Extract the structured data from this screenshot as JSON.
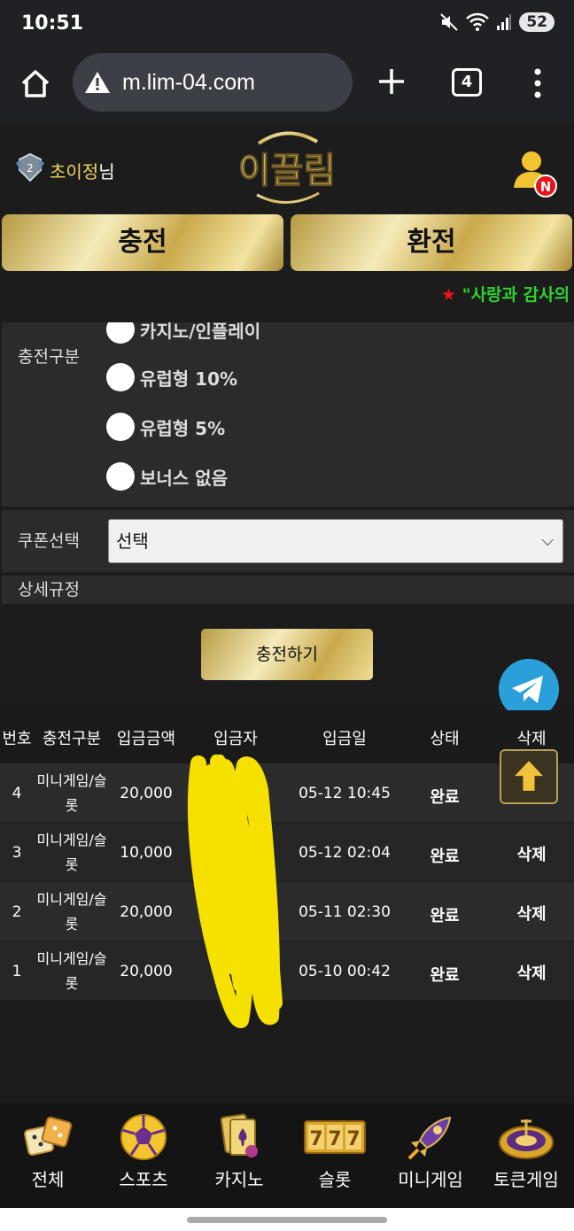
{
  "status_bar": {
    "time": "10:51",
    "battery": "52"
  },
  "browser": {
    "url": "m.lim-04.com",
    "tab_count": "4"
  },
  "header": {
    "username": "초이정",
    "username_suffix": "님",
    "logo_text": "이끌림",
    "notif_badge": "N"
  },
  "actions": {
    "charge": "충전",
    "exchange": "환전"
  },
  "marquee": {
    "star": "★",
    "text": "\"사랑과 감사의"
  },
  "form": {
    "type_label": "충전구분",
    "options": [
      "카지노/인플레이",
      "유럽형 10%",
      "유럽형 5%",
      "보너스 없음"
    ],
    "coupon_label": "쿠폰선택",
    "coupon_value": "선택",
    "detail_label": "상세규정",
    "submit": "충전하기"
  },
  "table": {
    "headers": [
      "번호",
      "충전구분",
      "입금금액",
      "입금자",
      "입금일",
      "상태",
      "삭제"
    ],
    "rows": [
      {
        "no": "4",
        "type_a": "미니게임/슬",
        "type_b": "롯",
        "amount": "20,000",
        "depositor": "",
        "date": "05-12 10:45",
        "status": "완료",
        "delete": ""
      },
      {
        "no": "3",
        "type_a": "미니게임/슬",
        "type_b": "롯",
        "amount": "10,000",
        "depositor": "",
        "date": "05-12 02:04",
        "status": "완료",
        "delete": "삭제"
      },
      {
        "no": "2",
        "type_a": "미니게임/슬",
        "type_b": "롯",
        "amount": "20,000",
        "depositor": "",
        "date": "05-11 02:30",
        "status": "완료",
        "delete": "삭제"
      },
      {
        "no": "1",
        "type_a": "미니게임/슬",
        "type_b": "롯",
        "amount": "20,000",
        "depositor": "",
        "date": "05-10 00:42",
        "status": "완료",
        "delete": "삭제"
      }
    ]
  },
  "bottom_nav": [
    {
      "label": "전체",
      "icon": "dice-icon"
    },
    {
      "label": "스포츠",
      "icon": "soccer-ball-icon"
    },
    {
      "label": "카지노",
      "icon": "cards-icon"
    },
    {
      "label": "슬롯",
      "icon": "slot-777-icon"
    },
    {
      "label": "미니게임",
      "icon": "rocket-icon"
    },
    {
      "label": "토큰게임",
      "icon": "roulette-icon"
    }
  ],
  "colors": {
    "gold": "#d9bf6a",
    "accent_green": "#2fd22f",
    "accent_red": "#e8141a",
    "telegram": "#2b9fd9"
  }
}
